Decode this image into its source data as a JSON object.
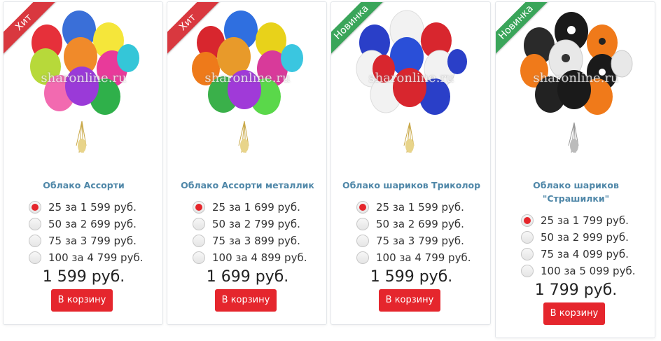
{
  "watermark": "sharonline.ru",
  "products": [
    {
      "ribbon": "Хит",
      "title": "Облако Ассорти",
      "options": [
        "25 за 1 599 руб.",
        "50 за 2 699 руб.",
        "75 за 3 799 руб.",
        "100 за 4 799 руб."
      ],
      "selected_option": 0,
      "price": "1 599 руб.",
      "button": "В корзину"
    },
    {
      "ribbon": "Хит",
      "title": "Облако Ассорти металлик",
      "options": [
        "25 за 1 699 руб.",
        "50 за 2 799 руб.",
        "75 за 3 899 руб.",
        "100 за 4 899 руб."
      ],
      "selected_option": 0,
      "price": "1 699 руб.",
      "button": "В корзину"
    },
    {
      "ribbon": "Новинка",
      "title": "Облако шариков Триколор",
      "options": [
        "25 за 1 599 руб.",
        "50 за 2 699 руб.",
        "75 за 3 799 руб.",
        "100 за 4 799 руб."
      ],
      "selected_option": 0,
      "price": "1 599 руб.",
      "button": "В корзину"
    },
    {
      "ribbon": "Новинка",
      "title_line1": "Облако шариков",
      "title_line2": "\"Страшилки\"",
      "options": [
        "25 за 1 799 руб.",
        "50 за 2 999 руб.",
        "75 за 4 099 руб.",
        "100 за 5 099 руб."
      ],
      "selected_option": 0,
      "price": "1 799 руб.",
      "button": "В корзину"
    }
  ],
  "colors": {
    "ribbon_hit": "#d9383f",
    "ribbon_new": "#3aa55a",
    "title": "#4f87a8",
    "button": "#e5262d",
    "radio_checked": "#e5252b"
  }
}
